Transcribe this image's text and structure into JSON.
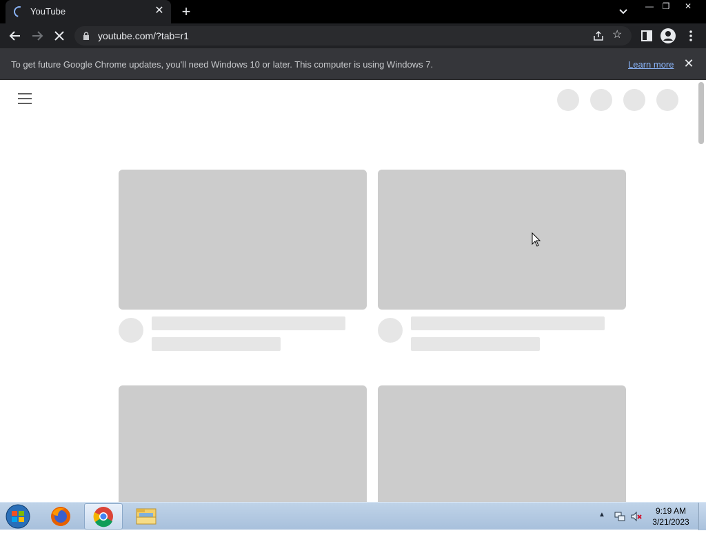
{
  "browser": {
    "tab": {
      "title": "YouTube",
      "close_icon": "close-icon"
    },
    "new_tab_icon": "plus-icon",
    "window_controls": {
      "minimize": "—",
      "restore": "❐",
      "close": "✕"
    },
    "address": {
      "url": "youtube.com/?tab=r1"
    }
  },
  "infobar": {
    "message": "To get future Google Chrome updates, you'll need Windows 10 or later. This computer is using Windows 7.",
    "link": "Learn more",
    "close": "✕"
  },
  "taskbar": {
    "apps": [
      "start-orb",
      "firefox",
      "chrome",
      "file-explorer"
    ],
    "clock": {
      "time": "9:19 AM",
      "date": "3/21/2023"
    }
  },
  "colors": {
    "chrome_dark": "#202124",
    "placeholder_thumb": "#cccccc",
    "placeholder_light": "#e6e6e6",
    "link": "#8ab4f8"
  }
}
